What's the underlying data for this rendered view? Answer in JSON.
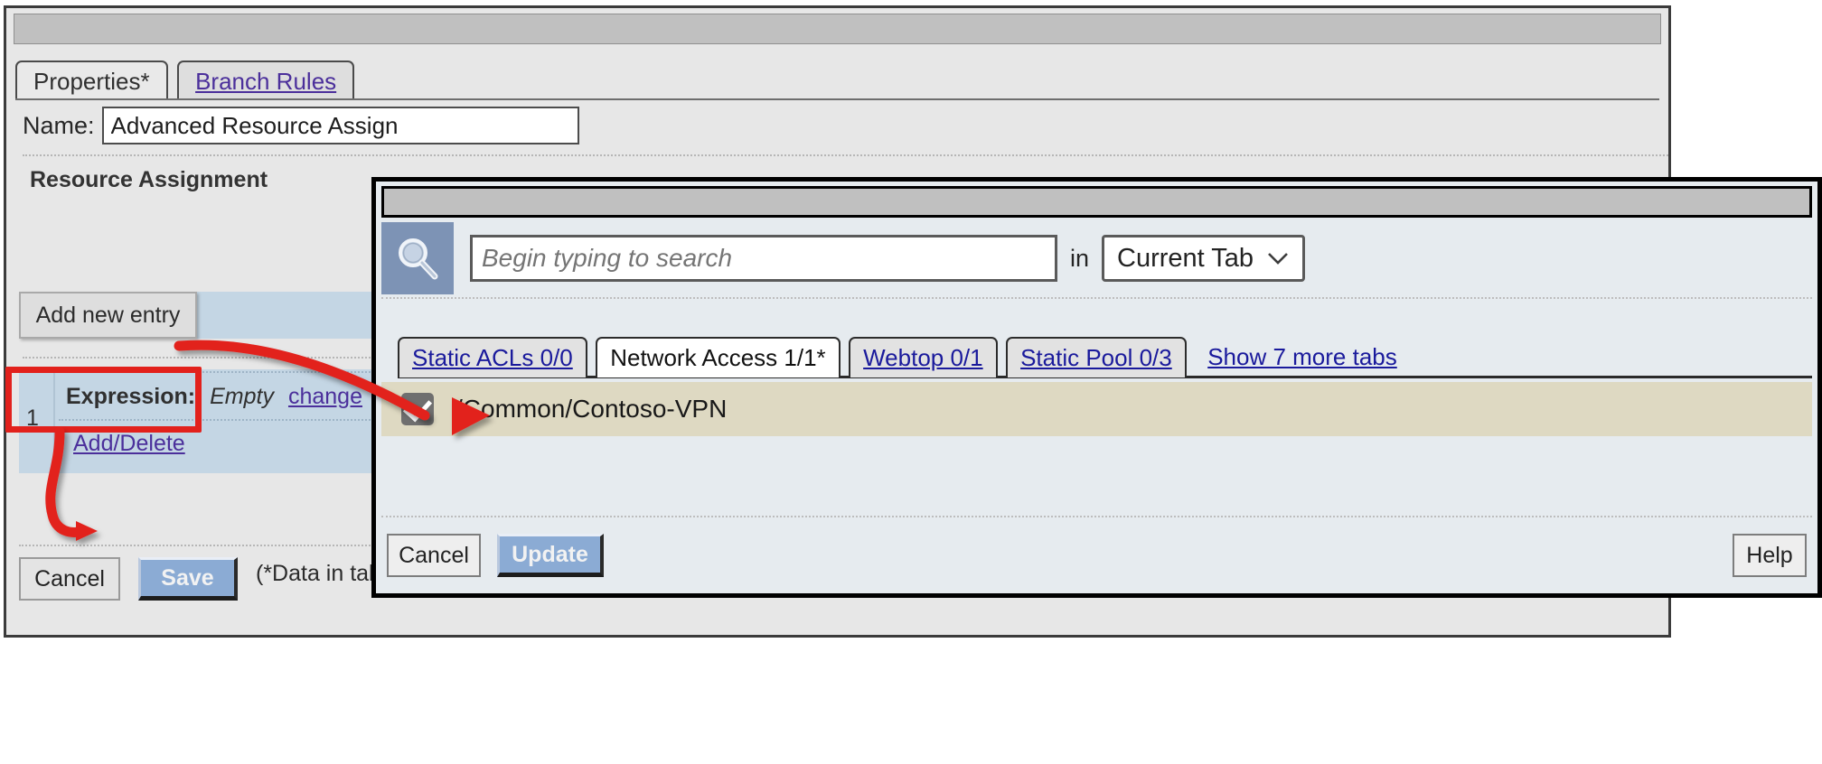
{
  "left_window": {
    "title": "",
    "tabs": [
      {
        "label": "Properties*",
        "active": true
      },
      {
        "label": "Branch Rules",
        "active": false
      }
    ],
    "name_field": {
      "label": "Name:",
      "value": "Advanced Resource Assign",
      "placeholder": ""
    },
    "section": {
      "title": "Resource Assignment",
      "add_new_entry_label": "Add new entry",
      "rows": [
        {
          "index": "1",
          "expression_label": "Expression:",
          "expression_value": "Empty",
          "change_link": "change",
          "add_delete_link": "Add/Delete"
        }
      ]
    },
    "footer": {
      "cancel_label": "Cancel",
      "save_label": "Save",
      "note": "(*Data in tab has"
    }
  },
  "right_dialog": {
    "title": "",
    "search": {
      "icon": "search-icon",
      "placeholder": "Begin typing to search",
      "value": "",
      "in_label": "in",
      "scope_selected": "Current Tab",
      "scope_options": [
        "Current Tab"
      ]
    },
    "tabs": [
      {
        "label": "Static ACLs 0/0",
        "active": false
      },
      {
        "label": "Network Access 1/1*",
        "active": true
      },
      {
        "label": "Webtop 0/1",
        "active": false
      },
      {
        "label": "Static Pool 0/3",
        "active": false
      }
    ],
    "show_more_tabs": "Show 7 more tabs",
    "results": [
      {
        "label": "/Common/Contoso-VPN",
        "checked": true
      }
    ],
    "footer": {
      "cancel_label": "Cancel",
      "update_label": "Update",
      "help_label": "Help"
    }
  },
  "annotations": {
    "highlight_color": "#e2211c",
    "arrow1": "add-new-entry-to-add-delete",
    "arrow2": "add-delete-to-checkbox"
  }
}
